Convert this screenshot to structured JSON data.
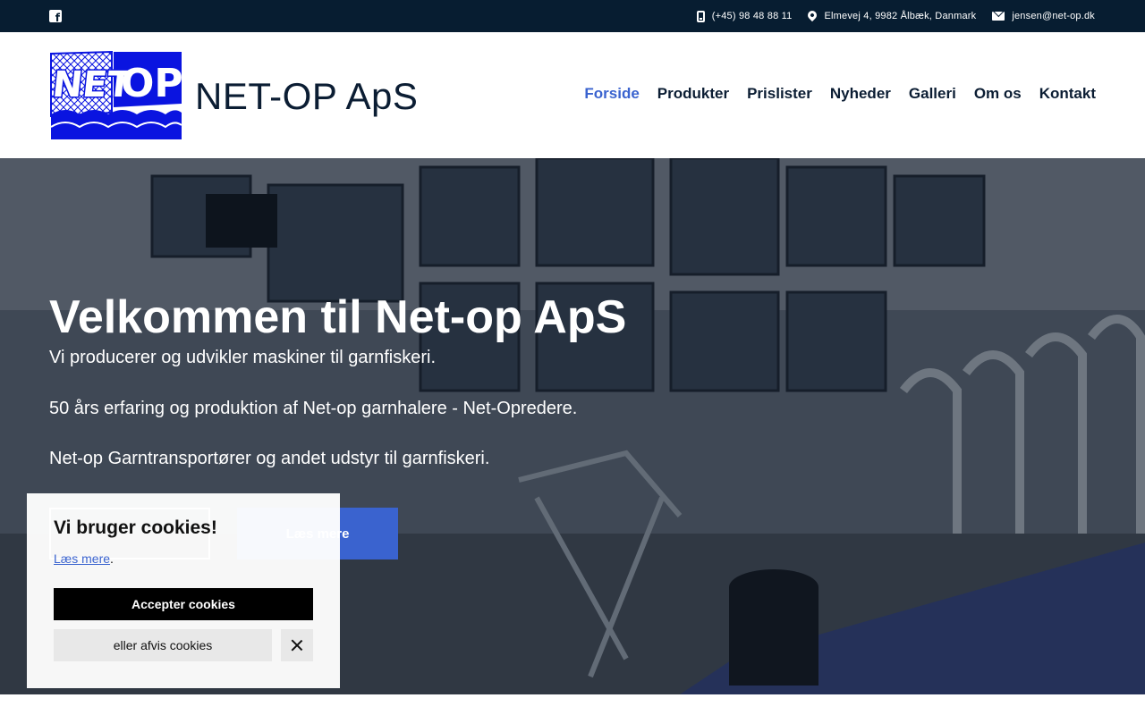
{
  "topbar": {
    "facebook_icon": "facebook-square-icon",
    "phone": "(+45) 98 48 88 11",
    "address": "Elmevej 4, 9982 Ålbæk, Danmark",
    "email": "jensen@net-op.dk"
  },
  "header": {
    "logo_text": "NET OP",
    "brand": "NET-OP ApS",
    "nav": [
      "Forside",
      "Produkter",
      "Prislister",
      "Nyheder",
      "Galleri",
      "Om os",
      "Kontakt"
    ]
  },
  "hero": {
    "title": "Velkommen til Net-op ApS",
    "lines": [
      "Vi producerer og udvikler maskiner til garnfiskeri.",
      "50 års erfaring og produktion af Net-op garnhalere - Net-Opredere.",
      "Net-op Garntransportører og andet udstyr til garnfiskeri."
    ],
    "button_secondary": "Læs mere"
  },
  "cookie": {
    "title": "Vi bruger cookies!",
    "link": "Læs mere",
    "dot": ".",
    "accept": "Accepter cookies",
    "reject": "eller afvis cookies"
  },
  "colors": {
    "topbar": "#071d31",
    "accent": "#3a63cf",
    "logo": "#0a14e0"
  }
}
